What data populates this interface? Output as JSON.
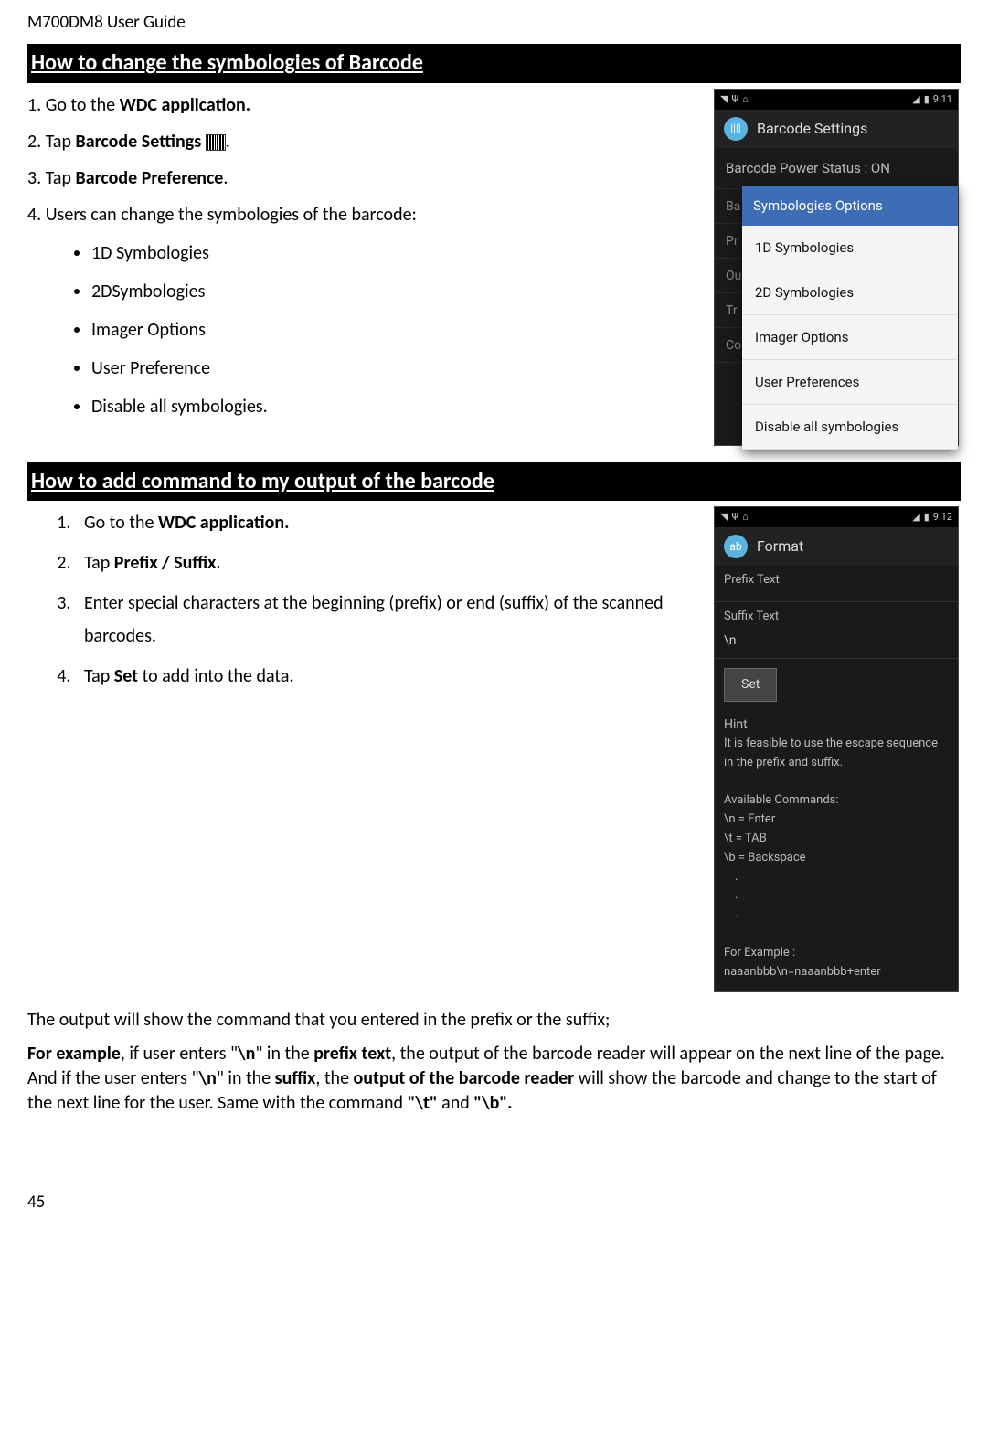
{
  "doc_header": "M700DM8 User Guide",
  "page_number": "45",
  "section1": {
    "title": "How to change the symbologies of Barcode",
    "steps": {
      "s1_pre": "1. Go to the ",
      "s1_bold": "WDC application.",
      "s2_pre": "2. Tap ",
      "s2_bold": "Barcode Settings ",
      "s2_post": ".",
      "s3_pre": "3. Tap ",
      "s3_bold": "Barcode Preference",
      "s3_post": ".",
      "s4": "4. Users can change the symbologies of the barcode:"
    },
    "bullets": [
      "1D Symbologies",
      "2DSymbologies",
      "Imager Options",
      "User Preference",
      "Disable all symbologies."
    ]
  },
  "phone1": {
    "time": "9:11",
    "app_title": "Barcode Settings",
    "power_status": "Barcode Power Status : ON",
    "bg_rows": [
      "Ba",
      "Pr",
      "Ou",
      "Tr",
      "Co"
    ],
    "popup_title": "Symbologies Options",
    "popup_items": [
      "1D Symbologies",
      "2D Symbologies",
      "Imager Options",
      "User Preferences",
      "Disable all symbologies"
    ]
  },
  "section2": {
    "title": "How to add command to my output of the barcode",
    "steps": {
      "s1_pre": "Go to the ",
      "s1_bold": "WDC application.",
      "s2_pre": "Tap ",
      "s2_bold": "Prefix / Suffix.",
      "s3": "Enter special characters at the beginning (prefix) or end (suffix) of the scanned barcodes.",
      "s4_pre": "Tap ",
      "s4_bold": "Set",
      "s4_post": " to add into the data."
    }
  },
  "phone2": {
    "time": "9:12",
    "app_title": "Format",
    "prefix_label": "Prefix Text",
    "prefix_value": "",
    "suffix_label": "Suffix Text",
    "suffix_value": "\\n",
    "set_btn": "Set",
    "hint_title": "Hint",
    "hint_line1": "It is feasible to use the escape sequence in the prefix and suffix.",
    "avail_title": "Available Commands:",
    "cmds": [
      "\\n = Enter",
      "\\t = TAB",
      "\\b = Backspace"
    ],
    "dots": [
      ".",
      ".",
      "."
    ],
    "example_title": "For Example :",
    "example_line": "naaanbbb\\n=naaanbbb+enter"
  },
  "para1": "The output will show the command that you entered in the prefix or the suffix;",
  "para2": {
    "t1": "For example",
    "t2": ", if user enters \"",
    "t3": "\\n",
    "t4": "\" in the ",
    "t5": "prefix text",
    "t6": ", the output of the barcode reader will appear on the next line of the page. And if the user enters \"",
    "t7": "\\n",
    "t8": "\" in the ",
    "t9": "suffix",
    "t10": ", the ",
    "t11": "output of the barcode reader",
    "t12": " will show the barcode and change to the start of the next line for the user. Same with the command ",
    "t13": "\"\\t\"",
    "t14": " and ",
    "t15": "\"\\b\"."
  }
}
